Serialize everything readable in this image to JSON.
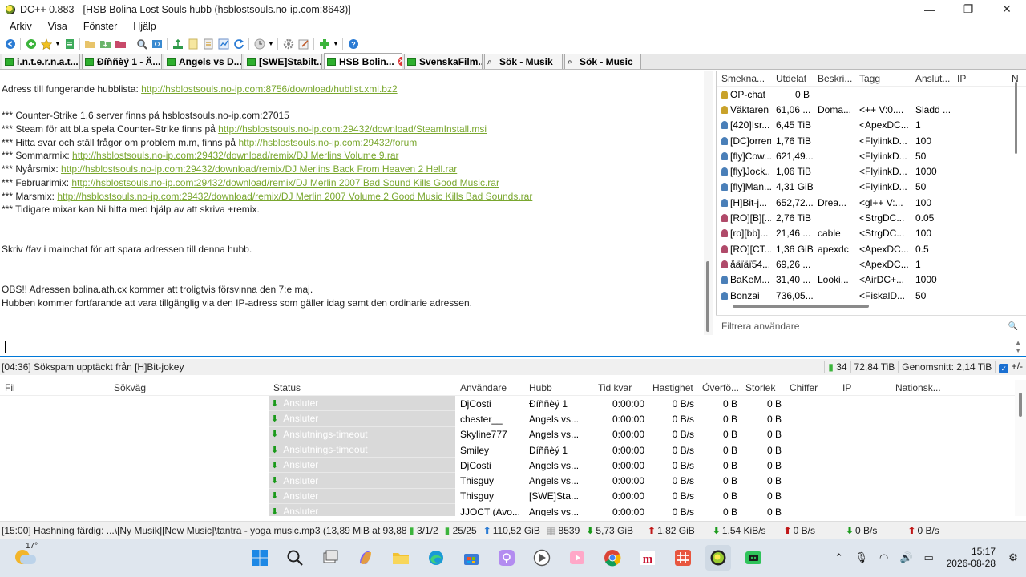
{
  "window": {
    "title": "DC++ 0.883 - [HSB Bolina Lost Souls hubb (hsblostsouls.no-ip.com:8643)]",
    "controls": [
      "—",
      "❐",
      "✕"
    ]
  },
  "menu": [
    "Arkiv",
    "Visa",
    "Fönster",
    "Hjälp"
  ],
  "tabs": [
    {
      "label": "i.n.t.e.r.n.a.t...",
      "type": "hub",
      "active": false
    },
    {
      "label": "Đíññèý 1 - Ä...",
      "type": "hub",
      "active": false
    },
    {
      "label": "Angels vs D...",
      "type": "hub",
      "active": false
    },
    {
      "label": "[SWE]Stabilt...",
      "type": "hub",
      "active": false
    },
    {
      "label": "HSB Bolin...",
      "type": "hub",
      "active": true
    },
    {
      "label": "SvenskaFilm...",
      "type": "hub",
      "active": false
    },
    {
      "label": "Sök - Musik",
      "type": "search",
      "active": false
    },
    {
      "label": "Sök - Music",
      "type": "search",
      "active": false
    }
  ],
  "chat": {
    "lines": [
      {
        "text": "Adress till fungerande hubblista: ",
        "link": "http://hsblostsouls.no-ip.com:8756/download/hublist.xml.bz2"
      },
      {
        "gap": true
      },
      {
        "text": "*** Counter-Strike 1.6 server finns på hsblostsouls.no-ip.com:27015"
      },
      {
        "text": "*** Steam för att bl.a spela Counter-Strike finns på ",
        "link": "http://hsblostsouls.no-ip.com:29432/download/SteamInstall.msi"
      },
      {
        "text": "*** Hitta svar och ställ frågor om problem m.m, finns på ",
        "link": "http://hsblostsouls.no-ip.com:29432/forum"
      },
      {
        "text": "*** Sommarmix: ",
        "link": "http://hsblostsouls.no-ip.com:29432/download/remix/DJ Merlins Volume 9.rar"
      },
      {
        "text": "*** Nyårsmix: ",
        "link": "http://hsblostsouls.no-ip.com:29432/download/remix/DJ Merlins Back From Heaven 2 Hell.rar"
      },
      {
        "text": "*** Februarimix: ",
        "link": "http://hsblostsouls.no-ip.com:29432/download/remix/DJ Merlin 2007 Bad Sound Kills Good Music.rar"
      },
      {
        "text": "*** Marsmix: ",
        "link": "http://hsblostsouls.no-ip.com:29432/download/remix/DJ Merlin 2007 Volume 2 Good Music Kills Bad Sounds.rar"
      },
      {
        "text": "*** Tidigare mixar kan Ni hitta med hjälp av att skriva +remix."
      },
      {
        "gap": true
      },
      {
        "gap": true
      },
      {
        "text": "Skriv /fav i mainchat för att spara adressen till denna hubb."
      },
      {
        "gap": true
      },
      {
        "gap": true
      },
      {
        "text": "OBS!! Adressen bolina.ath.cx kommer att troligtvis försvinna den 7:e maj."
      },
      {
        "text": "Hubben kommer fortfarande att vara tillgänglig via den IP-adress som gäller idag samt den ordinarie adressen."
      }
    ]
  },
  "users": {
    "columns": [
      "Smekna...",
      "Utdelat",
      "Beskri...",
      "Tagg",
      "Anslut...",
      "IP",
      "N"
    ],
    "rows": [
      {
        "nick": "OP-chat",
        "shared": "0 B",
        "desc": "",
        "tag": "",
        "conn": "",
        "icon": "op"
      },
      {
        "nick": "Väktaren",
        "shared": "61,06 ...",
        "desc": "Doma...",
        "tag": "<++ V:0....",
        "conn": "Sladd ...",
        "icon": "op"
      },
      {
        "nick": "[420]Isr...",
        "shared": "6,45 TiB",
        "desc": "",
        "tag": "<ApexDC...",
        "conn": "1",
        "icon": "user"
      },
      {
        "nick": "[DC]orren",
        "shared": "1,76 TiB",
        "desc": "",
        "tag": "<FlylinkD...",
        "conn": "100",
        "icon": "user"
      },
      {
        "nick": "[fly]Cow...",
        "shared": "621,49...",
        "desc": "",
        "tag": "<FlylinkD...",
        "conn": "50",
        "icon": "user"
      },
      {
        "nick": "[fly]Jock...",
        "shared": "1,06 TiB",
        "desc": "",
        "tag": "<FlylinkD...",
        "conn": "1000",
        "icon": "user"
      },
      {
        "nick": "[fly]Man...",
        "shared": "4,31 GiB",
        "desc": "",
        "tag": "<FlylinkD...",
        "conn": "50",
        "icon": "user"
      },
      {
        "nick": "[H]Bit-j...",
        "shared": "652,72...",
        "desc": "Drea...",
        "tag": "<gl++ V:...",
        "conn": "100",
        "icon": "user"
      },
      {
        "nick": "[RO][B][...",
        "shared": "2,76 TiB",
        "desc": "",
        "tag": "<StrgDC...",
        "conn": "0.05",
        "icon": "away"
      },
      {
        "nick": "[ro][bb]...",
        "shared": "21,46 ...",
        "desc": "cable",
        "tag": "<StrgDC...",
        "conn": "100",
        "icon": "away"
      },
      {
        "nick": "[RO][CT...",
        "shared": "1,36 GiB",
        "desc": "apexdc",
        "tag": "<ApexDC...",
        "conn": "0.5",
        "icon": "away"
      },
      {
        "nick": "åäïäï54...",
        "shared": "69,26 ...",
        "desc": "",
        "tag": "<ApexDC...",
        "conn": "1",
        "icon": "away"
      },
      {
        "nick": "BaKeM...",
        "shared": "31,40 ...",
        "desc": "Looki...",
        "tag": "<AirDC+...",
        "conn": "1000",
        "icon": "user"
      },
      {
        "nick": "Bonzai",
        "shared": "736,05...",
        "desc": "",
        "tag": "<FiskalD...",
        "conn": "50",
        "icon": "user"
      }
    ],
    "filter_placeholder": "Filtrera användare"
  },
  "hub_status": {
    "message": "[04:36] Sökspam upptäckt från [H]Bit-jokey",
    "users": "34",
    "share": "72,84 TiB",
    "average": "Genomsnitt: 2,14 TiB",
    "toggle": "+/-"
  },
  "queue": {
    "columns": [
      "Fil",
      "Sökväg",
      "Status",
      "Användare",
      "Hubb",
      "Tid kvar",
      "Hastighet",
      "Överfö...",
      "Storlek",
      "Chiffer",
      "IP",
      "Nationsk..."
    ],
    "rows": [
      {
        "status": "Ansluter",
        "user": "DjCosti",
        "hub": "Đíññèý 1",
        "time": "0:00:00",
        "speed": "0 B/s",
        "transferred": "0 B",
        "size": "0 B"
      },
      {
        "status": "Ansluter",
        "user": "chester__",
        "hub": "Angels vs...",
        "time": "0:00:00",
        "speed": "0 B/s",
        "transferred": "0 B",
        "size": "0 B"
      },
      {
        "status": "Anslutnings-timeout",
        "user": "Skyline777",
        "hub": "Angels vs...",
        "time": "0:00:00",
        "speed": "0 B/s",
        "transferred": "0 B",
        "size": "0 B"
      },
      {
        "status": "Anslutnings-timeout",
        "user": "Smiley",
        "hub": "Đíññèý 1",
        "time": "0:00:00",
        "speed": "0 B/s",
        "transferred": "0 B",
        "size": "0 B"
      },
      {
        "status": "Ansluter",
        "user": "DjCosti",
        "hub": "Angels vs...",
        "time": "0:00:00",
        "speed": "0 B/s",
        "transferred": "0 B",
        "size": "0 B"
      },
      {
        "status": "Ansluter",
        "user": "Thisguy",
        "hub": "Angels vs...",
        "time": "0:00:00",
        "speed": "0 B/s",
        "transferred": "0 B",
        "size": "0 B"
      },
      {
        "status": "Ansluter",
        "user": "Thisguy",
        "hub": "[SWE]Sta...",
        "time": "0:00:00",
        "speed": "0 B/s",
        "transferred": "0 B",
        "size": "0 B"
      },
      {
        "status": "Ansluter",
        "user": "JJOCT (Avo...",
        "hub": "Angels vs...",
        "time": "0:00:00",
        "speed": "0 B/s",
        "transferred": "0 B",
        "size": "0 B"
      }
    ]
  },
  "status_bar": {
    "message": "[15:00] Hashning färdig: ...\\[Ny Musik][New Music]\\tantra - yoga music.mp3 (13,89 MiB at 93,88",
    "hubs": "3/1/2",
    "slots": "25/25",
    "uploaded_total": "110,52 GiB",
    "shared_files": "8539",
    "downloaded_total": "5,73 GiB",
    "up_total2": "1,82 GiB",
    "down_speed": "1,54 KiB/s",
    "up_speed": "0 B/s",
    "down_speed2": "0 B/s",
    "up_speed2": "0 B/s"
  },
  "taskbar": {
    "temperature": "17°",
    "time": "15:17",
    "date": "2026-08-28"
  },
  "colors": {
    "link": "#7aa72f",
    "accent": "#0078d7",
    "status_cell": "#d9d9d9"
  }
}
